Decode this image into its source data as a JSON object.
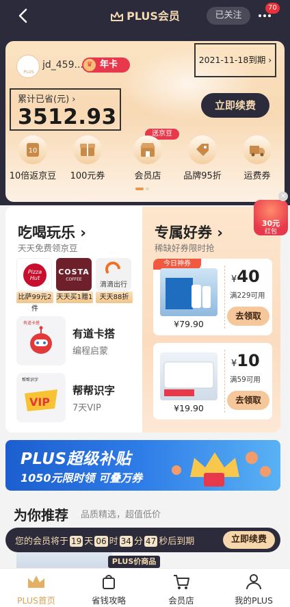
{
  "header": {
    "title": "PLUS会员",
    "follow_label": "已关注",
    "more_badge": "70"
  },
  "card": {
    "username": "jd_459...",
    "tier_label": "年卡",
    "expire_label": "2021-11-18到期 ›",
    "saved_label": "累计已省(元) ›",
    "saved_value": "3512.93",
    "renew_label": "立即续费",
    "send_tag": "送京豆",
    "perks": [
      {
        "label": "10倍返京豆",
        "icon": "jingdou-icon"
      },
      {
        "label": "100元券",
        "icon": "coupon-gift-icon"
      },
      {
        "label": "会员店",
        "icon": "store-icon"
      },
      {
        "label": "品牌95折",
        "icon": "brand-discount-icon"
      },
      {
        "label": "运费券",
        "icon": "shipping-icon"
      }
    ]
  },
  "food": {
    "title": "吃喝玩乐 ›",
    "subtitle": "天天免费领京豆",
    "brands": [
      {
        "name": "Pizza Hut",
        "caption": "比萨99元2件",
        "color": "#c8102e"
      },
      {
        "name": "COSTA",
        "caption": "天天买1赠1",
        "sub": "COFFEE",
        "color": "#6d1f2a"
      },
      {
        "name": "滴滴出行",
        "caption": "天天88折",
        "color": "#f2f2f2"
      }
    ],
    "apps": [
      {
        "name": "有道卡搭",
        "desc": "编程启蒙",
        "logo_text": "有道卡搭"
      },
      {
        "name": "帮帮识字",
        "desc": "7天VIP",
        "logo_text": "帮帮识字",
        "vip": "VIP"
      }
    ]
  },
  "coupons": {
    "title": "专属好券 ›",
    "subtitle": "稀缺好券限时抢",
    "today_tag": "今日神券",
    "items": [
      {
        "price": "¥79.90",
        "amount": "40",
        "condition": "满229可用",
        "button": "去领取"
      },
      {
        "price": "¥19.90",
        "amount": "10",
        "condition": "满59可用",
        "button": "去领取"
      }
    ]
  },
  "redpack": {
    "amount": "30元",
    "label": "红包"
  },
  "banner": {
    "title": "PLUS超级补贴",
    "subtitle": "1050元限时领 可叠万券"
  },
  "recommend": {
    "title": "为你推荐",
    "subtitle": "品质精选，超值低价",
    "countdown_prefix": "您的会员将于",
    "days": "19",
    "unit_day": "天",
    "hours": "06",
    "unit_hour": "时",
    "minutes": "34",
    "unit_min": "分",
    "seconds": "47",
    "unit_sec": "秒后到期",
    "renew_label": "立即续费",
    "product_tag": "PLUS价商品"
  },
  "tabs": [
    {
      "label": "PLUS首页",
      "icon": "crown-icon",
      "active": true
    },
    {
      "label": "省钱攻略",
      "icon": "shopping-bag-icon"
    },
    {
      "label": "会员店",
      "icon": "cart-icon"
    },
    {
      "label": "我的PLUS",
      "icon": "person-icon"
    }
  ],
  "colors": {
    "header_bg": "#2b2b3b",
    "gold": "#f5d9b0",
    "red": "#e8384b",
    "active_tab": "#d9a45a"
  }
}
